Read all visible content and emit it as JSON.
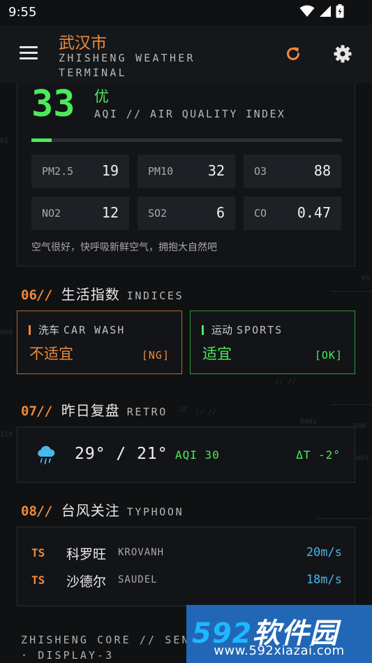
{
  "status_bar": {
    "time": "9:55"
  },
  "header": {
    "city": "武汉市",
    "subtitle": "ZHISHENG WEATHER TERMINAL"
  },
  "aqi": {
    "value": "33",
    "level": "优",
    "label": "AQI // AIR QUALITY INDEX",
    "bar_fraction": 0.066,
    "pollutants": [
      {
        "name": "PM2.5",
        "value": "19"
      },
      {
        "name": "PM10",
        "value": "32"
      },
      {
        "name": "O3",
        "value": "88"
      },
      {
        "name": "NO2",
        "value": "12"
      },
      {
        "name": "SO2",
        "value": "6"
      },
      {
        "name": "CO",
        "value": "0.47"
      }
    ],
    "advice": "空气很好，快呼吸新鲜空气，拥抱大自然吧"
  },
  "sections": {
    "indices": {
      "num": "06",
      "slash": "//",
      "zh": "生活指数",
      "en": "INDICES"
    },
    "retro": {
      "num": "07",
      "slash": "//",
      "zh": "昨日复盘",
      "en": "RETRO"
    },
    "typhoon": {
      "num": "08",
      "slash": "//",
      "zh": "台风关注",
      "en": "TYPHOON"
    }
  },
  "indices": [
    {
      "zh": "洗车",
      "en": "CAR WASH",
      "status": "不适宜",
      "tag": "[NG]",
      "color": "#f08a3c",
      "border": "#b9652c"
    },
    {
      "zh": "运动",
      "en": "SPORTS",
      "status": "适宜",
      "tag": "[OK]",
      "color": "#4cea5a",
      "border": "#2f9b3a"
    }
  ],
  "retro": {
    "temps": "29° / 21°",
    "aqi": "AQI 30",
    "delta": "ΔT -2°",
    "icon": "rain-cloud-icon"
  },
  "typhoons": [
    {
      "tag": "TS",
      "zh": "科罗旺",
      "en": "KROVANH",
      "speed": "20m/s"
    },
    {
      "tag": "TS",
      "zh": "沙德尔",
      "en": "SAUDEL",
      "speed": "18m/s"
    }
  ],
  "footer": {
    "line1": "ZHISHENG CORE // SEN",
    "line2": "· DISPLAY-3"
  },
  "watermark": {
    "logo_digits": "592",
    "logo_text": "软件园",
    "url": "www.592xiazai.com"
  },
  "decor": {
    "d1": "01",
    "d2": "// //",
    "d3": "0001",
    "d4": "10",
    "d5": "// //",
    "d6": "110",
    "d7": "000",
    "d8": "001"
  },
  "colors": {
    "accent": "#f08a3c",
    "good": "#4cea5a",
    "info": "#49b7ea"
  }
}
